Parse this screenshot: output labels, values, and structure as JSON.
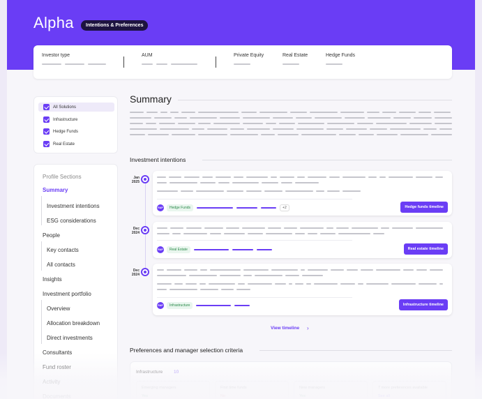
{
  "hero": {
    "title": "Alpha",
    "badge": "Intentions & Preferences",
    "color": "#6a3df5"
  },
  "summary_card": {
    "columns": [
      {
        "label": "Investor type"
      },
      {
        "label": "AUM"
      },
      {
        "label": "Private Equity"
      },
      {
        "label": "Real Estate"
      },
      {
        "label": "Hedge Funds"
      }
    ]
  },
  "filters": [
    {
      "label": "All Solutions",
      "checked": true,
      "active": true
    },
    {
      "label": "Infrastructure",
      "checked": true
    },
    {
      "label": "Hedge Funds",
      "checked": true
    },
    {
      "label": "Real Estate",
      "checked": true
    }
  ],
  "sections": {
    "heading": "Profile Sections",
    "items": [
      {
        "label": "Summary",
        "active": true
      },
      {
        "label": "Investment intentions",
        "sub": true
      },
      {
        "label": "ESG considerations",
        "sub": true
      },
      {
        "label": "People"
      },
      {
        "label": "Key contacts",
        "sub": true
      },
      {
        "label": "All contacts",
        "sub": true
      },
      {
        "label": "Insights"
      },
      {
        "label": "Investment portfolio"
      },
      {
        "label": "Overview",
        "sub": true
      },
      {
        "label": "Allocation breakdown",
        "sub": true
      },
      {
        "label": "Direct investments",
        "sub": true
      },
      {
        "label": "Consultants"
      },
      {
        "label": "Fund roster"
      },
      {
        "label": "Activity"
      },
      {
        "label": "Documents"
      }
    ]
  },
  "main": {
    "title": "Summary",
    "intentions_title": "Investment intentions",
    "intentions": [
      {
        "month": "Jan",
        "year": "2025",
        "logo": "RAP",
        "tag": "Hedge Funds",
        "more": "+2",
        "button": "Hedge funds timeline"
      },
      {
        "month": "Dec",
        "year": "2024",
        "logo": "RAP",
        "tag": "Real Estate",
        "button": "Real estate timeline"
      },
      {
        "month": "Dec",
        "year": "2024",
        "logo": "RAP",
        "tag": "Infrastructure",
        "button": "Infrastructure timeline"
      }
    ],
    "view_timeline": "View timeline",
    "prefs_title": "Preferences and manager selection criteria",
    "prefs": {
      "head": "Infrastructure",
      "count": "10",
      "columns": [
        {
          "label": "Emerging managers",
          "value": "Yes"
        },
        {
          "label": "First time funds",
          "value": "No"
        },
        {
          "label": "New managers",
          "value": "Yes"
        },
        {
          "label": "7 more preferences available",
          "value": "See all"
        }
      ]
    }
  }
}
